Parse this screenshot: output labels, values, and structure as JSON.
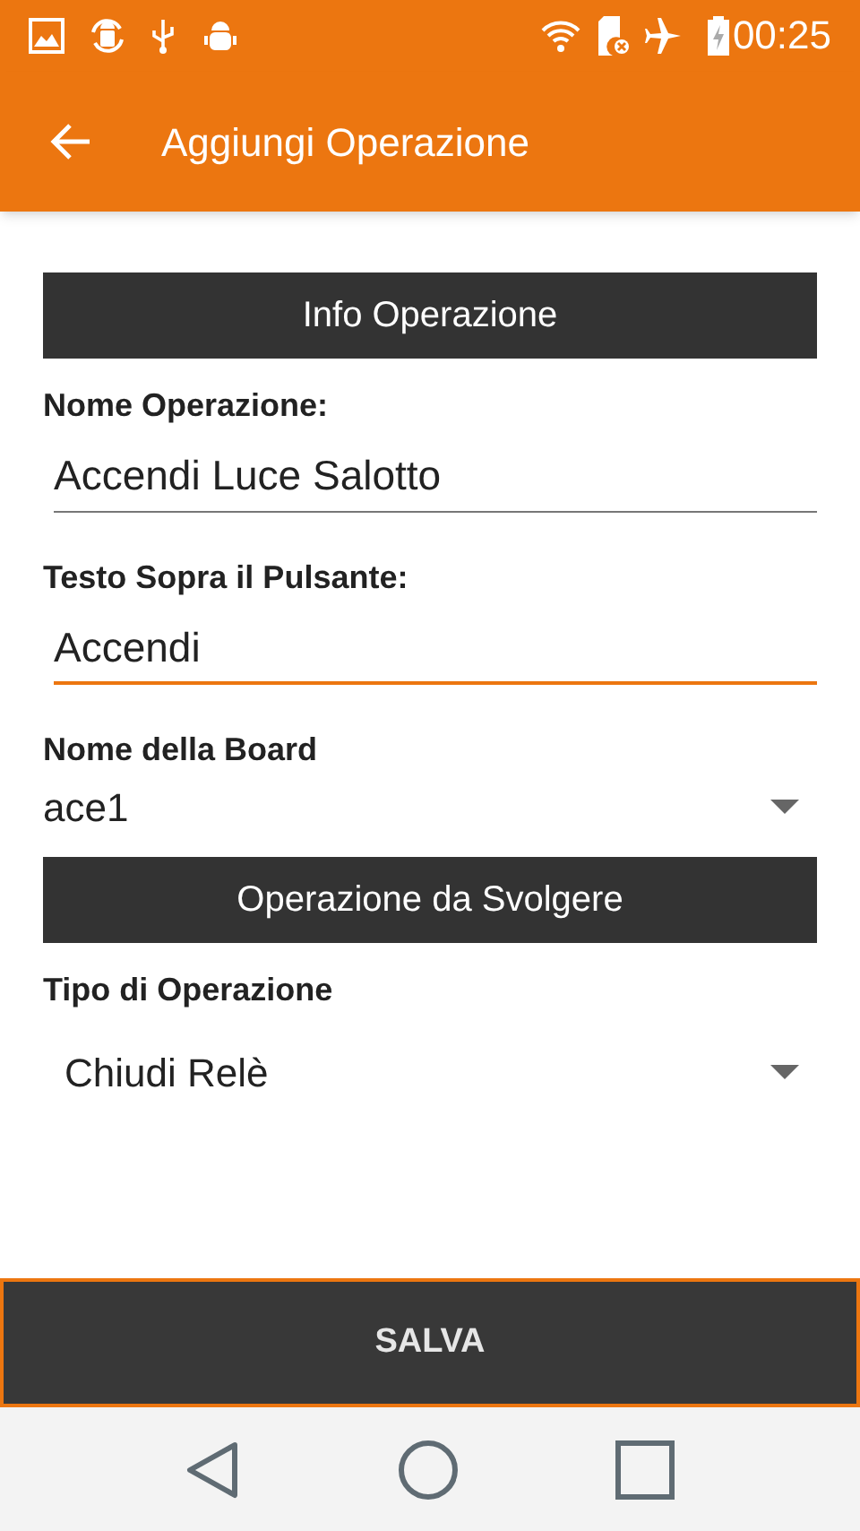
{
  "status_bar": {
    "time": "00:25"
  },
  "app_bar": {
    "title": "Aggiungi Operazione"
  },
  "sections": [
    {
      "header": "Info Operazione",
      "fields": [
        {
          "kind": "text",
          "label": "Nome Operazione:",
          "value": "Accendi Luce Salotto",
          "focused": false
        },
        {
          "kind": "text",
          "label": "Testo Sopra il Pulsante:",
          "value": "Accendi",
          "focused": true
        },
        {
          "kind": "dropdown",
          "label": "Nome della Board",
          "value": "ace1"
        }
      ]
    },
    {
      "header": "Operazione da Svolgere",
      "fields": [
        {
          "kind": "dropdown",
          "label": "Tipo di Operazione",
          "value": "Chiudi Relè"
        }
      ]
    }
  ],
  "save_button": {
    "label": "SALVA"
  }
}
